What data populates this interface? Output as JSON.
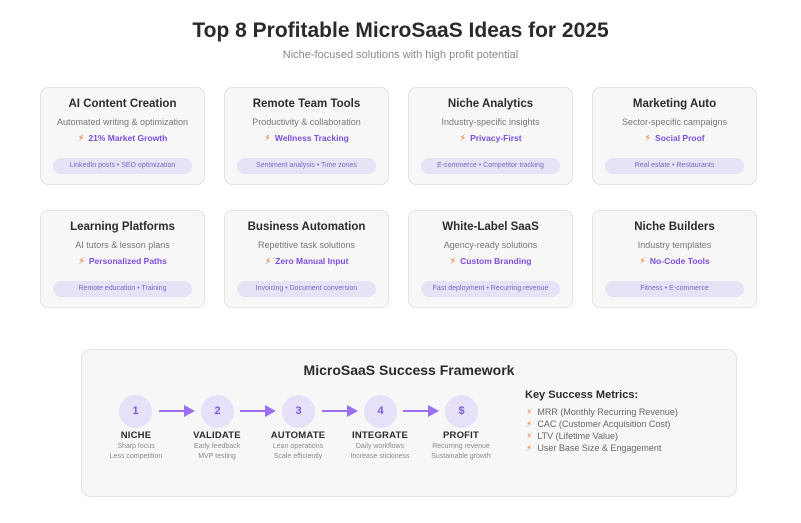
{
  "title": "Top 8 Profitable MicroSaaS Ideas for 2025",
  "subtitle": "Niche-focused solutions with high profit potential",
  "icons": {
    "highlight": "lightning-bolt-icon",
    "flow": "arrow-right-icon"
  },
  "colors": {
    "accent": "#7c4ddb",
    "bolt": "#f07a3a",
    "tag_bg": "#e7e3f7",
    "circle_bg": "#e6e0f8"
  },
  "cards": [
    {
      "title": "AI Content Creation",
      "desc": "Automated writing & optimization",
      "highlight": "21% Market Growth",
      "tags": "LinkedIn posts • SEO optimization"
    },
    {
      "title": "Remote Team Tools",
      "desc": "Productivity & collaboration",
      "highlight": "Wellness Tracking",
      "tags": "Sentiment analysis • Time zones"
    },
    {
      "title": "Niche Analytics",
      "desc": "Industry-specific insights",
      "highlight": "Privacy-First",
      "tags": "E-commerce • Competitor tracking"
    },
    {
      "title": "Marketing Auto",
      "desc": "Sector-specific campaigns",
      "highlight": "Social Proof",
      "tags": "Real estate • Restaurants"
    },
    {
      "title": "Learning Platforms",
      "desc": "AI tutors & lesson plans",
      "highlight": "Personalized Paths",
      "tags": "Remote education • Training"
    },
    {
      "title": "Business Automation",
      "desc": "Repetitive task solutions",
      "highlight": "Zero Manual Input",
      "tags": "Invoicing • Document conversion"
    },
    {
      "title": "White-Label SaaS",
      "desc": "Agency-ready solutions",
      "highlight": "Custom Branding",
      "tags": "Fast deployment • Recurring revenue"
    },
    {
      "title": "Niche Builders",
      "desc": "Industry templates",
      "highlight": "No-Code Tools",
      "tags": "Fitness • E-commerce"
    }
  ],
  "framework": {
    "title": "MicroSaaS Success Framework",
    "steps": [
      {
        "number": "1",
        "name": "NICHE",
        "line1": "Sharp focus",
        "line2": "Less competition"
      },
      {
        "number": "2",
        "name": "VALIDATE",
        "line1": "Early feedback",
        "line2": "MVP testing"
      },
      {
        "number": "3",
        "name": "AUTOMATE",
        "line1": "Lean operations",
        "line2": "Scale efficiently"
      },
      {
        "number": "4",
        "name": "INTEGRATE",
        "line1": "Daily workflows",
        "line2": "Increase stickiness"
      },
      {
        "number": "$",
        "name": "PROFIT",
        "line1": "Recurring revenue",
        "line2": "Sustainable growth"
      }
    ],
    "metrics_title": "Key Success Metrics:",
    "metrics": [
      "MRR (Monthly Recurring Revenue)",
      "CAC (Customer Acquisition Cost)",
      "LTV (Lifetime Value)",
      "User Base Size & Engagement"
    ]
  }
}
